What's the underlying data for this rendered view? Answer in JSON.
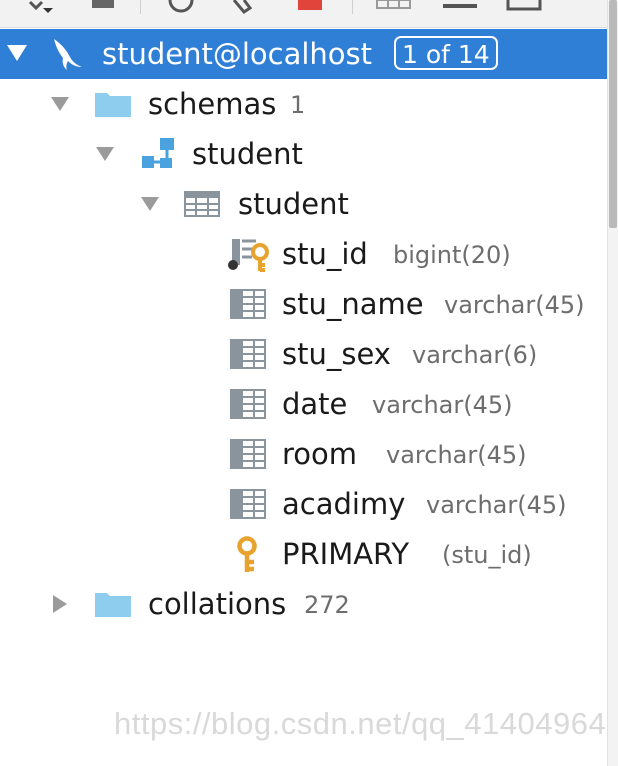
{
  "connection": {
    "label": "student@localhost",
    "badge": "1 of 14"
  },
  "schemas": {
    "label": "schemas",
    "count": "1"
  },
  "schema": {
    "label": "student"
  },
  "table": {
    "label": "student"
  },
  "columns": [
    {
      "name": "stu_id",
      "type": "bigint(20)"
    },
    {
      "name": "stu_name",
      "type": "varchar(45)"
    },
    {
      "name": "stu_sex",
      "type": "varchar(6)"
    },
    {
      "name": "date",
      "type": "varchar(45)"
    },
    {
      "name": "room",
      "type": "varchar(45)"
    },
    {
      "name": "acadimy",
      "type": "varchar(45)"
    }
  ],
  "index": {
    "name": "PRIMARY",
    "columns": "(stu_id)"
  },
  "collations": {
    "label": "collations",
    "count": "272"
  },
  "watermark": "https://blog.csdn.net/qq_41404964",
  "colors": {
    "selection": "#2f7fd6",
    "folder": "#8fcdee",
    "key": "#e8a32e",
    "column_icon": "#8a949c"
  }
}
